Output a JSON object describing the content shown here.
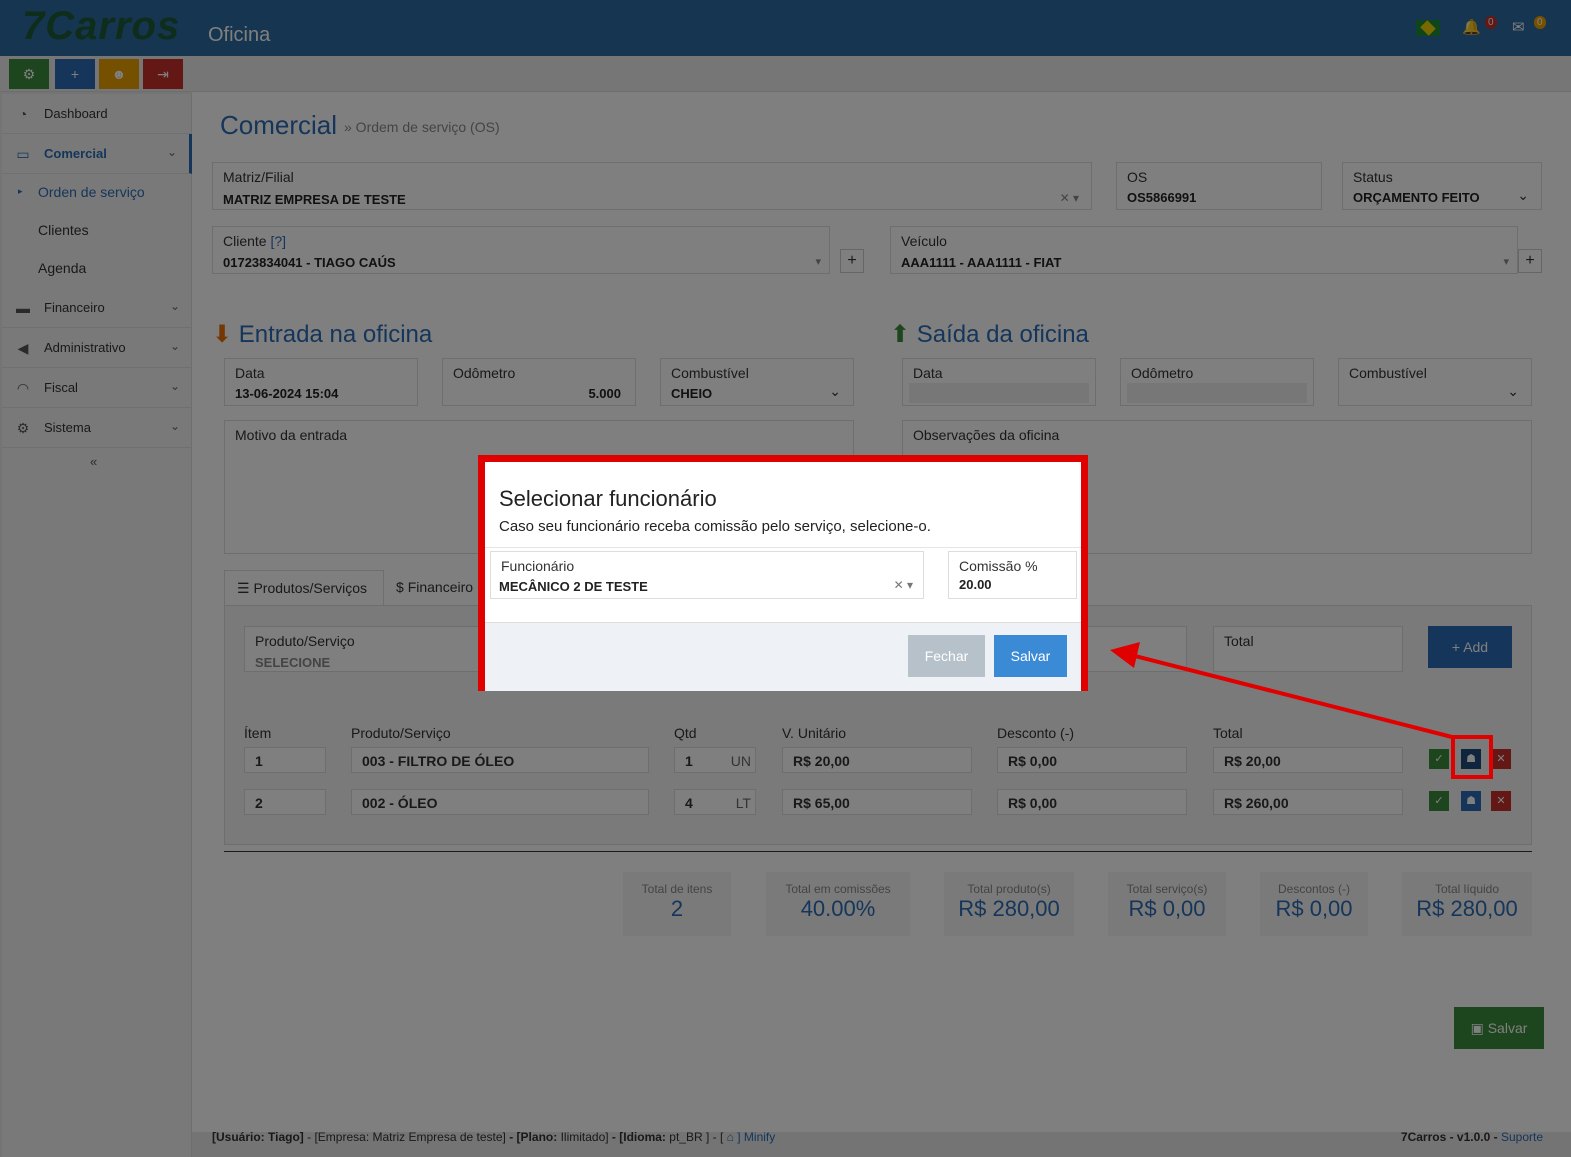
{
  "header": {
    "logo": "7Carros",
    "logo_sub": "Oficina",
    "notif_count": "0",
    "mail_count": "0"
  },
  "sidebar": {
    "items": [
      {
        "label": "Dashboard"
      },
      {
        "label": "Comercial"
      },
      {
        "label": "Financeiro"
      },
      {
        "label": "Administrativo"
      },
      {
        "label": "Fiscal"
      },
      {
        "label": "Sistema"
      }
    ],
    "subitems": [
      {
        "label": "Orden de serviço"
      },
      {
        "label": "Clientes"
      },
      {
        "label": "Agenda"
      }
    ],
    "collapse": "«"
  },
  "page": {
    "title": "Comercial",
    "breadcrumb": "» Ordem de serviço (OS)"
  },
  "form": {
    "matriz_label": "Matriz/Filial",
    "matriz_value": "MATRIZ EMPRESA DE TESTE",
    "os_label": "OS",
    "os_value": "OS5866991",
    "status_label": "Status",
    "status_value": "ORÇAMENTO FEITO",
    "cliente_label": "Cliente",
    "cliente_help": "[?]",
    "cliente_value": "01723834041 - TIAGO CAÚS",
    "veiculo_label": "Veículo",
    "veiculo_value": "AAA1111 - AAA1111 - FIAT"
  },
  "entrada": {
    "title": "Entrada na oficina",
    "data_label": "Data",
    "data_value": "13-06-2024 15:04",
    "odometro_label": "Odômetro",
    "odometro_value": "5.000",
    "combustivel_label": "Combustível",
    "combustivel_value": "CHEIO",
    "motivo_label": "Motivo da entrada"
  },
  "saida": {
    "title": "Saída da oficina",
    "data_label": "Data",
    "odometro_label": "Odômetro",
    "combustivel_label": "Combustível",
    "obs_label": "Observações da oficina"
  },
  "tabs": [
    {
      "label": "Produtos/Serviços"
    },
    {
      "label": "Financeiro"
    }
  ],
  "add_row": {
    "produto_label": "Produto/Serviço",
    "produto_value": "SELECIONE",
    "total_label": "Total",
    "add_button": "Add"
  },
  "table": {
    "headers": [
      "Ítem",
      "Produto/Serviço",
      "Qtd",
      "V. Unitário",
      "Desconto (-)",
      "Total"
    ],
    "rows": [
      {
        "item": "1",
        "produto": "003 - FILTRO DE ÓLEO",
        "qtd": "1",
        "unit": "UN",
        "vunit": "R$ 20,00",
        "desconto": "R$ 0,00",
        "total": "R$ 20,00"
      },
      {
        "item": "2",
        "produto": "002 - ÓLEO",
        "qtd": "4",
        "unit": "LT",
        "vunit": "R$ 65,00",
        "desconto": "R$ 0,00",
        "total": "R$ 260,00"
      }
    ]
  },
  "summary": [
    {
      "label": "Total de itens",
      "value": "2"
    },
    {
      "label": "Total em comissões",
      "value": "40.00%"
    },
    {
      "label": "Total produto(s)",
      "value": "R$ 280,00"
    },
    {
      "label": "Total serviço(s)",
      "value": "R$ 0,00"
    },
    {
      "label": "Descontos (-)",
      "value": "R$ 0,00"
    },
    {
      "label": "Total líquido",
      "value": "R$ 280,00"
    }
  ],
  "save_button": "Salvar",
  "modal": {
    "title": "Selecionar funcionário",
    "subtitle": "Caso seu funcionário receba comissão pelo serviço, selecione-o.",
    "funcionario_label": "Funcionário",
    "funcionario_value": "MECÂNICO 2 DE TESTE",
    "comissao_label": "Comissão %",
    "comissao_value": "20.00",
    "close_button": "Fechar",
    "save_button": "Salvar"
  },
  "footer": {
    "left_parts": [
      "[Usuário:",
      "Tiago]",
      " - [Empresa:",
      "Matriz Empresa de teste]",
      " - [Plano:",
      "Ilimitado]",
      " - [Idioma:",
      "pt_BR ]",
      " - [",
      "] Minify"
    ],
    "right_app": "7Carros - v1.0.0 - ",
    "right_link": "Suporte"
  },
  "colors": {
    "accent": "#2a6db5",
    "highlight": "#e00000",
    "success": "#3c8d3c",
    "danger": "#c9302c",
    "warning": "#e8a000"
  }
}
